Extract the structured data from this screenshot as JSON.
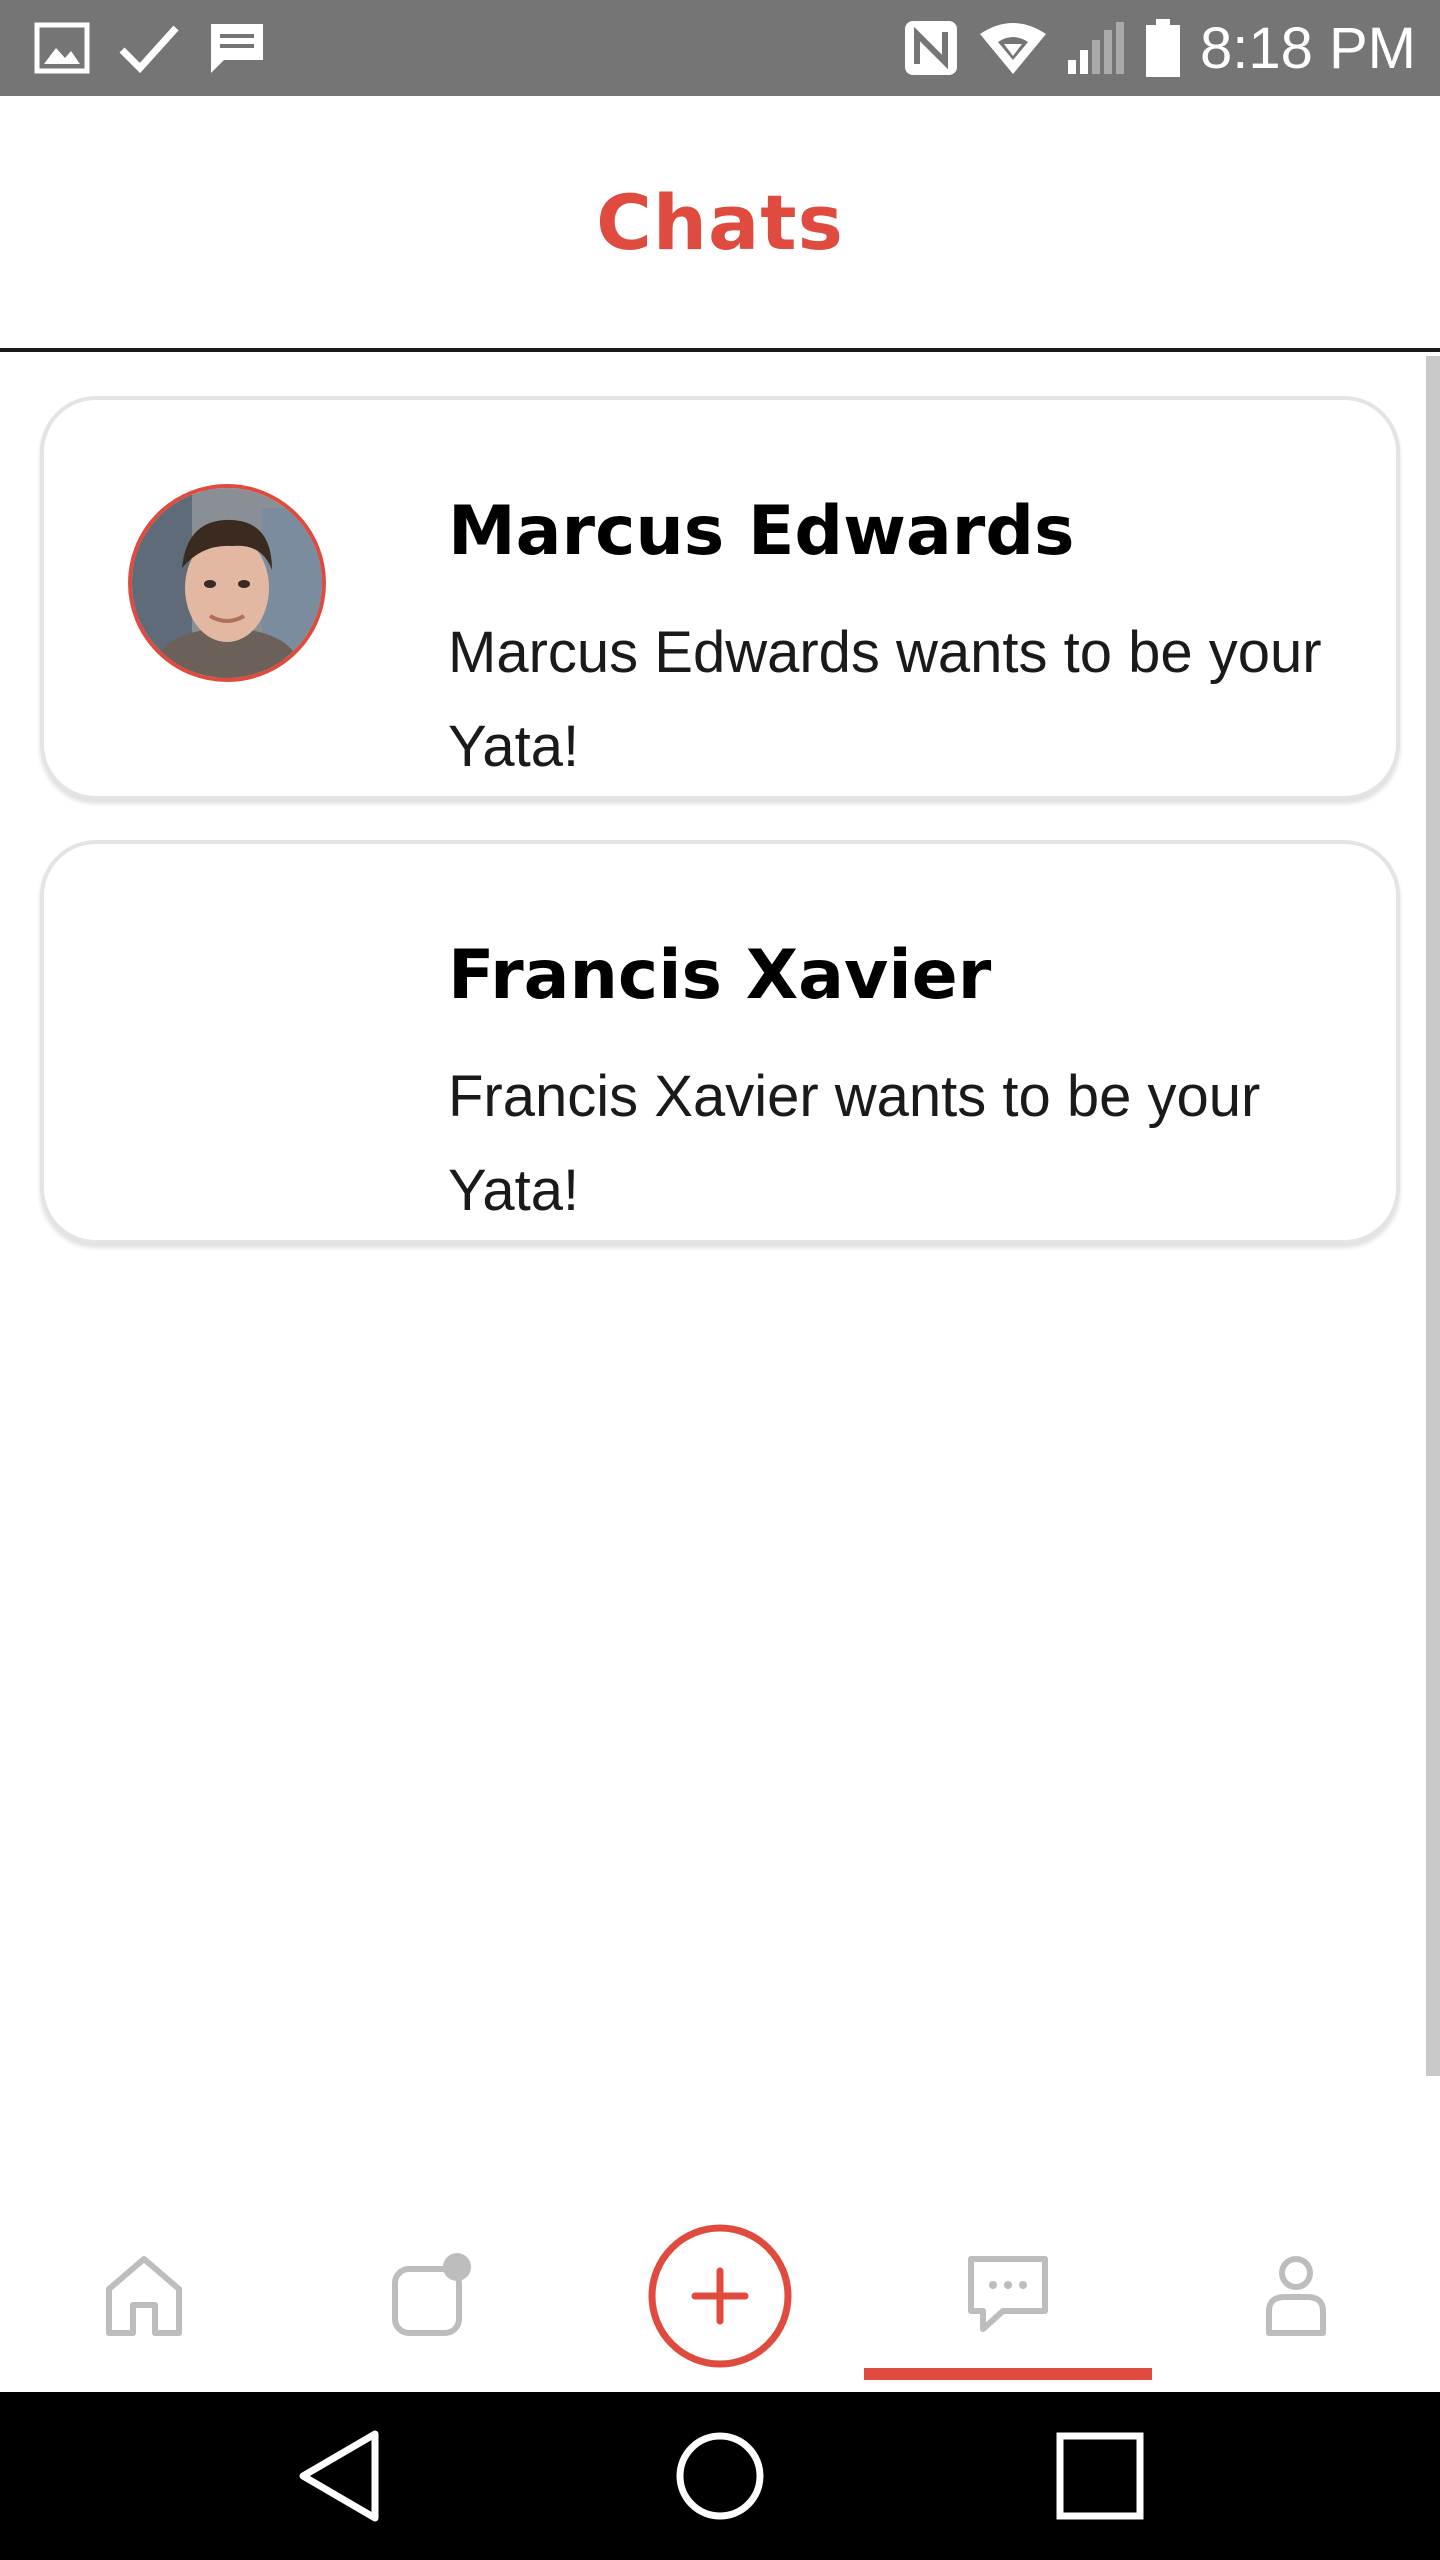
{
  "status_bar": {
    "time": "8:18 PM",
    "left_icons": [
      "image-icon",
      "check-icon",
      "message-icon"
    ],
    "right_icons": [
      "nfc-icon",
      "wifi-icon",
      "signal-icon",
      "battery-icon"
    ]
  },
  "header": {
    "title": "Chats"
  },
  "chats": [
    {
      "name": "Marcus Edwards",
      "message": "Marcus Edwards wants to be your Yata!",
      "has_avatar": true
    },
    {
      "name": "Francis Xavier",
      "message": "Francis Xavier wants to be your Yata!",
      "has_avatar": false
    }
  ],
  "bottom_nav": {
    "items": [
      "home-icon",
      "notes-icon",
      "add-icon",
      "chat-icon",
      "profile-icon"
    ],
    "active": "chat-icon"
  },
  "system_nav": {
    "items": [
      "back-icon",
      "home-circle-icon",
      "recents-icon"
    ]
  },
  "colors": {
    "accent": "#e04b3f",
    "status_bar": "#757575",
    "nav_icon": "#bdbdbd"
  }
}
